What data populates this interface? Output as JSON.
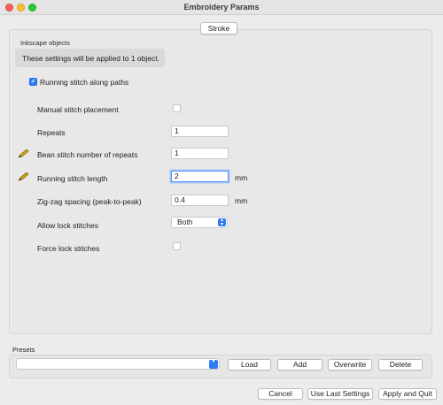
{
  "window": {
    "title": "Embroidery Params"
  },
  "tabs": [
    {
      "label": "Stroke"
    }
  ],
  "group": {
    "title": "Inkscape objects",
    "info": "These settings will be applied to 1 object."
  },
  "enable": {
    "label": "Running stitch along paths",
    "checked": true
  },
  "params": {
    "manual": {
      "label": "Manual stitch placement",
      "checked": false
    },
    "repeats": {
      "label": "Repeats",
      "value": "1"
    },
    "bean": {
      "label": "Bean stitch number of repeats",
      "value": "1",
      "icon": "pencil-icon"
    },
    "running": {
      "label": "Running stitch length",
      "value": "2",
      "unit": "mm",
      "icon": "pencil-icon"
    },
    "zigzag": {
      "label": "Zig-zag spacing (peak-to-peak)",
      "value": "0.4",
      "unit": "mm"
    },
    "lock": {
      "label": "Allow lock stitches",
      "value": "Both"
    },
    "force": {
      "label": "Force lock stitches",
      "checked": false
    }
  },
  "presets": {
    "title": "Presets",
    "value": "",
    "load": "Load",
    "add": "Add",
    "overwrite": "Overwrite",
    "delete": "Delete"
  },
  "footer": {
    "cancel": "Cancel",
    "use_last": "Use Last Settings",
    "apply": "Apply and Quit"
  },
  "colors": {
    "accent": "#2f7bf5",
    "focus_ring": "#4d90f3",
    "pencil": "#d9a600"
  }
}
